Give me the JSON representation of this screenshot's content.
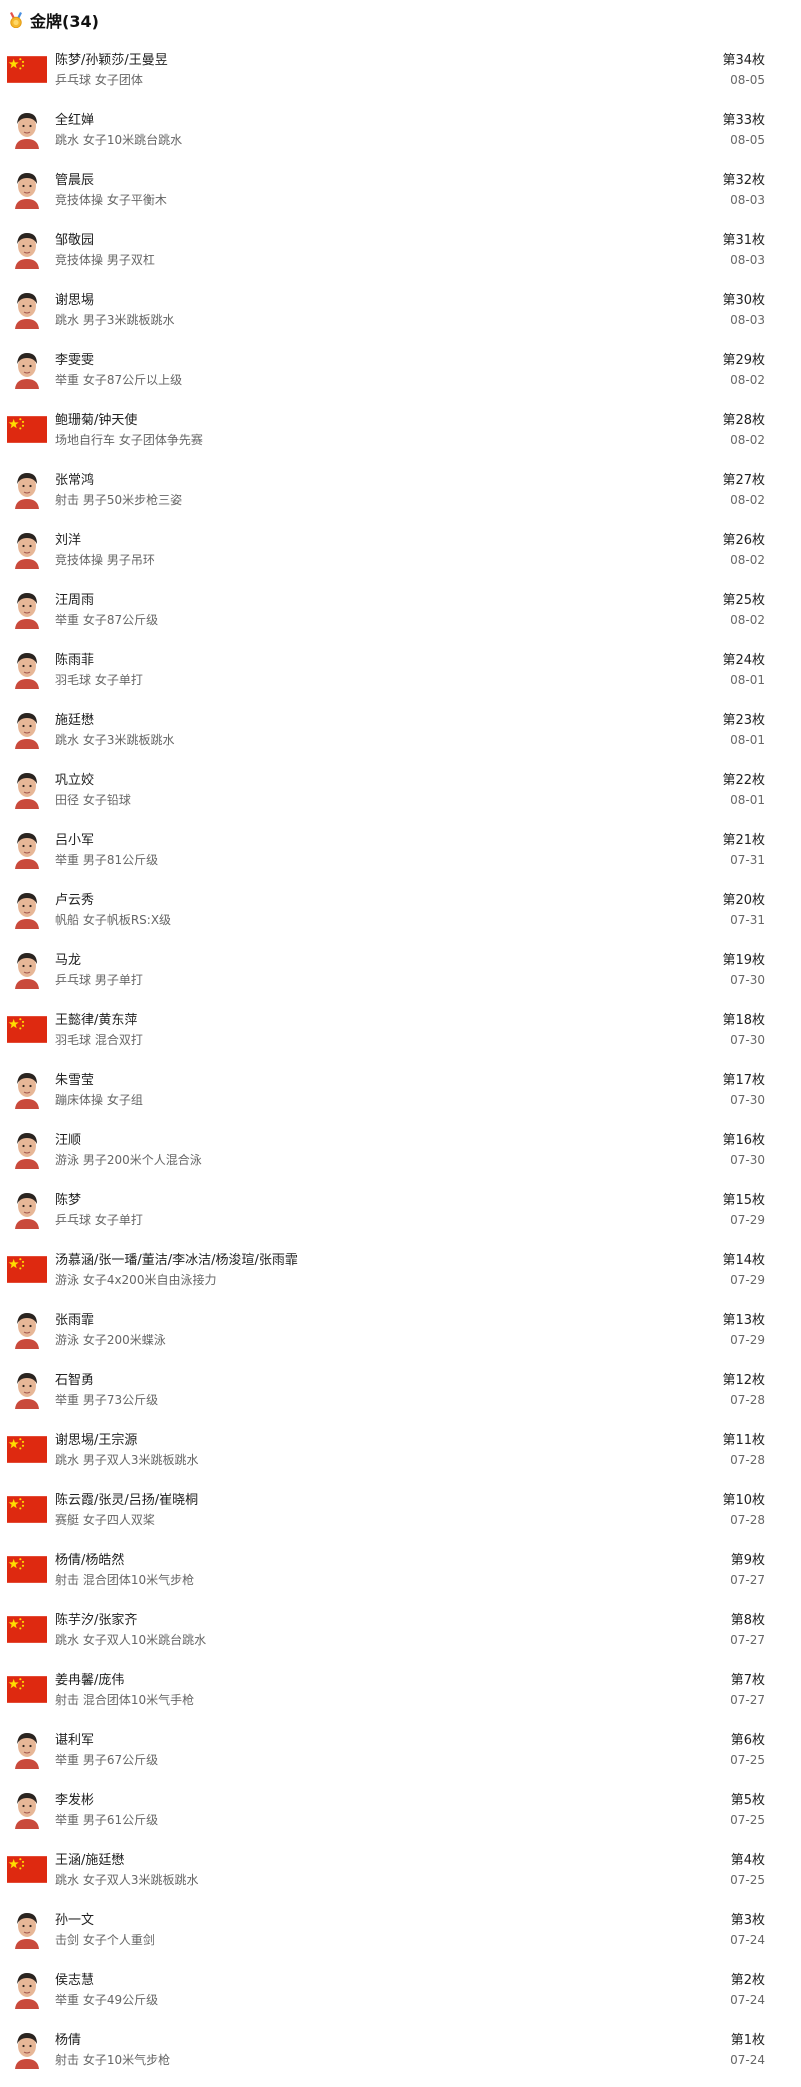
{
  "header": {
    "title": "金牌(34)",
    "icon": "gold-medal-icon"
  },
  "colors": {
    "flag_red": "#DE2910",
    "flag_star": "#FFDE00",
    "rank_text": "#222222",
    "secondary_text": "#666666"
  },
  "items": [
    {
      "thumb": "flag",
      "name": "陈梦/孙颖莎/王曼昱",
      "event": "乒乓球 女子团体",
      "rank": "第34枚",
      "date": "08-05"
    },
    {
      "thumb": "avatar",
      "name": "全红婵",
      "event": "跳水 女子10米跳台跳水",
      "rank": "第33枚",
      "date": "08-05"
    },
    {
      "thumb": "avatar",
      "name": "管晨辰",
      "event": "竞技体操 女子平衡木",
      "rank": "第32枚",
      "date": "08-03"
    },
    {
      "thumb": "avatar",
      "name": "邹敬园",
      "event": "竞技体操 男子双杠",
      "rank": "第31枚",
      "date": "08-03"
    },
    {
      "thumb": "avatar",
      "name": "谢思埸",
      "event": "跳水 男子3米跳板跳水",
      "rank": "第30枚",
      "date": "08-03"
    },
    {
      "thumb": "avatar",
      "name": "李雯雯",
      "event": "举重 女子87公斤以上级",
      "rank": "第29枚",
      "date": "08-02"
    },
    {
      "thumb": "flag",
      "name": "鲍珊菊/钟天使",
      "event": "场地自行车 女子团体争先赛",
      "rank": "第28枚",
      "date": "08-02"
    },
    {
      "thumb": "avatar",
      "name": "张常鸿",
      "event": "射击 男子50米步枪三姿",
      "rank": "第27枚",
      "date": "08-02"
    },
    {
      "thumb": "avatar",
      "name": "刘洋",
      "event": "竞技体操 男子吊环",
      "rank": "第26枚",
      "date": "08-02"
    },
    {
      "thumb": "avatar",
      "name": "汪周雨",
      "event": "举重 女子87公斤级",
      "rank": "第25枚",
      "date": "08-02"
    },
    {
      "thumb": "avatar",
      "name": "陈雨菲",
      "event": "羽毛球 女子单打",
      "rank": "第24枚",
      "date": "08-01"
    },
    {
      "thumb": "avatar",
      "name": "施廷懋",
      "event": "跳水 女子3米跳板跳水",
      "rank": "第23枚",
      "date": "08-01"
    },
    {
      "thumb": "avatar",
      "name": "巩立姣",
      "event": "田径 女子铅球",
      "rank": "第22枚",
      "date": "08-01"
    },
    {
      "thumb": "avatar",
      "name": "吕小军",
      "event": "举重 男子81公斤级",
      "rank": "第21枚",
      "date": "07-31"
    },
    {
      "thumb": "avatar",
      "name": "卢云秀",
      "event": "帆船 女子帆板RS:X级",
      "rank": "第20枚",
      "date": "07-31"
    },
    {
      "thumb": "avatar",
      "name": "马龙",
      "event": "乒乓球 男子单打",
      "rank": "第19枚",
      "date": "07-30"
    },
    {
      "thumb": "flag",
      "name": "王懿律/黄东萍",
      "event": "羽毛球 混合双打",
      "rank": "第18枚",
      "date": "07-30"
    },
    {
      "thumb": "avatar",
      "name": "朱雪莹",
      "event": "蹦床体操 女子组",
      "rank": "第17枚",
      "date": "07-30"
    },
    {
      "thumb": "avatar",
      "name": "汪顺",
      "event": "游泳 男子200米个人混合泳",
      "rank": "第16枚",
      "date": "07-30"
    },
    {
      "thumb": "avatar",
      "name": "陈梦",
      "event": "乒乓球 女子单打",
      "rank": "第15枚",
      "date": "07-29"
    },
    {
      "thumb": "flag",
      "name": "汤慕涵/张一璠/董洁/李冰洁/杨浚瑄/张雨霏",
      "event": "游泳 女子4x200米自由泳接力",
      "rank": "第14枚",
      "date": "07-29"
    },
    {
      "thumb": "avatar",
      "name": "张雨霏",
      "event": "游泳 女子200米蝶泳",
      "rank": "第13枚",
      "date": "07-29"
    },
    {
      "thumb": "avatar",
      "name": "石智勇",
      "event": "举重 男子73公斤级",
      "rank": "第12枚",
      "date": "07-28"
    },
    {
      "thumb": "flag",
      "name": "谢思埸/王宗源",
      "event": "跳水 男子双人3米跳板跳水",
      "rank": "第11枚",
      "date": "07-28"
    },
    {
      "thumb": "flag",
      "name": "陈云霞/张灵/吕扬/崔晓桐",
      "event": "赛艇 女子四人双桨",
      "rank": "第10枚",
      "date": "07-28"
    },
    {
      "thumb": "flag",
      "name": "杨倩/杨皓然",
      "event": "射击 混合团体10米气步枪",
      "rank": "第9枚",
      "date": "07-27"
    },
    {
      "thumb": "flag",
      "name": "陈芋汐/张家齐",
      "event": "跳水 女子双人10米跳台跳水",
      "rank": "第8枚",
      "date": "07-27"
    },
    {
      "thumb": "flag",
      "name": "姜冉馨/庞伟",
      "event": "射击 混合团体10米气手枪",
      "rank": "第7枚",
      "date": "07-27"
    },
    {
      "thumb": "avatar",
      "name": "谌利军",
      "event": "举重 男子67公斤级",
      "rank": "第6枚",
      "date": "07-25"
    },
    {
      "thumb": "avatar",
      "name": "李发彬",
      "event": "举重 男子61公斤级",
      "rank": "第5枚",
      "date": "07-25"
    },
    {
      "thumb": "flag",
      "name": "王涵/施廷懋",
      "event": "跳水 女子双人3米跳板跳水",
      "rank": "第4枚",
      "date": "07-25"
    },
    {
      "thumb": "avatar",
      "name": "孙一文",
      "event": "击剑 女子个人重剑",
      "rank": "第3枚",
      "date": "07-24"
    },
    {
      "thumb": "avatar",
      "name": "侯志慧",
      "event": "举重 女子49公斤级",
      "rank": "第2枚",
      "date": "07-24"
    },
    {
      "thumb": "avatar",
      "name": "杨倩",
      "event": "射击 女子10米气步枪",
      "rank": "第1枚",
      "date": "07-24"
    }
  ]
}
